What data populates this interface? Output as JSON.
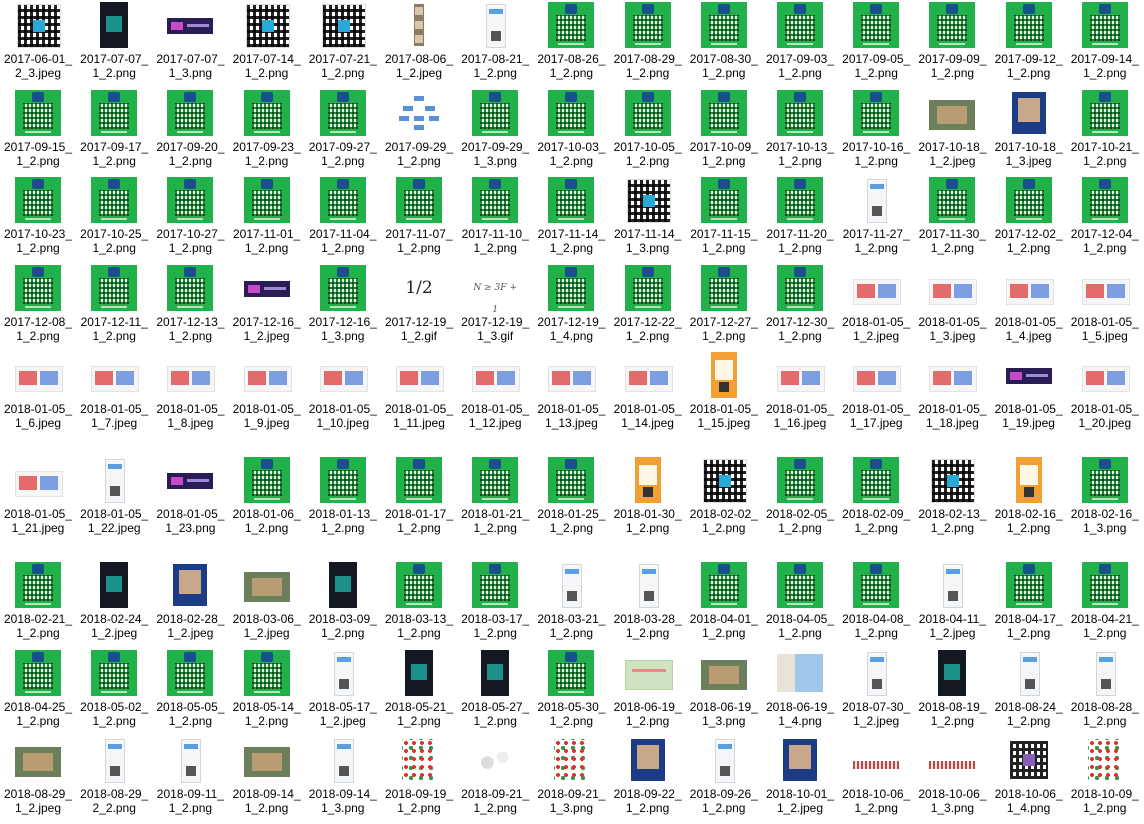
{
  "files": [
    {
      "name": "2017-06-01_2_3.jpeg",
      "thumb": "qr-plain"
    },
    {
      "name": "2017-07-07_1_2.png",
      "thumb": "dark-poster"
    },
    {
      "name": "2017-07-07_1_3.png",
      "thumb": "banner"
    },
    {
      "name": "2017-07-14_1_2.png",
      "thumb": "qr-plain"
    },
    {
      "name": "2017-07-21_1_2.png",
      "thumb": "qr-plain"
    },
    {
      "name": "2017-08-06_1_2.jpeg",
      "thumb": "strip"
    },
    {
      "name": "2017-08-21_1_2.png",
      "thumb": "doc"
    },
    {
      "name": "2017-08-26_1_2.png",
      "thumb": "qr-green"
    },
    {
      "name": "2017-08-29_1_2.png",
      "thumb": "qr-green"
    },
    {
      "name": "2017-08-30_1_2.png",
      "thumb": "qr-green"
    },
    {
      "name": "2017-09-03_1_2.png",
      "thumb": "qr-green"
    },
    {
      "name": "2017-09-05_1_2.png",
      "thumb": "qr-green"
    },
    {
      "name": "2017-09-09_1_2.png",
      "thumb": "qr-green"
    },
    {
      "name": "2017-09-12_1_2.png",
      "thumb": "qr-green"
    },
    {
      "name": "2017-09-14_1_2.png",
      "thumb": "qr-green"
    },
    {
      "name": "2017-09-15_1_2.png",
      "thumb": "qr-green"
    },
    {
      "name": "2017-09-17_1_2.png",
      "thumb": "qr-green"
    },
    {
      "name": "2017-09-20_1_2.png",
      "thumb": "qr-green"
    },
    {
      "name": "2017-09-23_1_2.png",
      "thumb": "qr-green"
    },
    {
      "name": "2017-09-27_1_2.png",
      "thumb": "qr-green"
    },
    {
      "name": "2017-09-29_1_2.png",
      "thumb": "flow"
    },
    {
      "name": "2017-09-29_1_3.png",
      "thumb": "qr-green"
    },
    {
      "name": "2017-10-03_1_2.png",
      "thumb": "qr-green"
    },
    {
      "name": "2017-10-05_1_2.png",
      "thumb": "qr-green"
    },
    {
      "name": "2017-10-09_1_2.png",
      "thumb": "qr-green"
    },
    {
      "name": "2017-10-13_1_2.png",
      "thumb": "qr-green"
    },
    {
      "name": "2017-10-16_1_2.png",
      "thumb": "qr-green"
    },
    {
      "name": "2017-10-18_1_2.jpeg",
      "thumb": "photo"
    },
    {
      "name": "2017-10-18_1_3.jpeg",
      "thumb": "poster"
    },
    {
      "name": "2017-10-21_1_2.png",
      "thumb": "qr-green"
    },
    {
      "name": "2017-10-23_1_2.png",
      "thumb": "qr-green"
    },
    {
      "name": "2017-10-25_1_2.png",
      "thumb": "qr-green"
    },
    {
      "name": "2017-10-27_1_2.png",
      "thumb": "qr-green"
    },
    {
      "name": "2017-11-01_1_2.png",
      "thumb": "qr-green"
    },
    {
      "name": "2017-11-04_1_2.png",
      "thumb": "qr-green"
    },
    {
      "name": "2017-11-07_1_2.png",
      "thumb": "qr-green"
    },
    {
      "name": "2017-11-10_1_2.png",
      "thumb": "qr-green"
    },
    {
      "name": "2017-11-14_1_2.png",
      "thumb": "qr-green"
    },
    {
      "name": "2017-11-14_1_3.png",
      "thumb": "qr-plain"
    },
    {
      "name": "2017-11-15_1_2.png",
      "thumb": "qr-green"
    },
    {
      "name": "2017-11-20_1_2.png",
      "thumb": "qr-green"
    },
    {
      "name": "2017-11-27_1_2.png",
      "thumb": "doc"
    },
    {
      "name": "2017-11-30_1_2.png",
      "thumb": "qr-green"
    },
    {
      "name": "2017-12-02_1_2.png",
      "thumb": "qr-green"
    },
    {
      "name": "2017-12-04_1_2.png",
      "thumb": "qr-green"
    },
    {
      "name": "2017-12-08_1_2.png",
      "thumb": "qr-green"
    },
    {
      "name": "2017-12-11_1_2.png",
      "thumb": "qr-green"
    },
    {
      "name": "2017-12-13_1_2.png",
      "thumb": "qr-green"
    },
    {
      "name": "2017-12-16_1_2.jpeg",
      "thumb": "banner"
    },
    {
      "name": "2017-12-16_1_3.png",
      "thumb": "qr-green"
    },
    {
      "name": "2017-12-19_1_2.gif",
      "thumb": "gif-half",
      "math": "1/2"
    },
    {
      "name": "2017-12-19_1_3.gif",
      "thumb": "gif-formula",
      "math": "N ≥ 3F + 1"
    },
    {
      "name": "2017-12-19_1_4.png",
      "thumb": "qr-green"
    },
    {
      "name": "2017-12-22_1_2.png",
      "thumb": "qr-green"
    },
    {
      "name": "2017-12-27_1_2.png",
      "thumb": "qr-green"
    },
    {
      "name": "2017-12-30_1_2.png",
      "thumb": "qr-green"
    },
    {
      "name": "2018-01-05_1_2.jpeg",
      "thumb": "wide"
    },
    {
      "name": "2018-01-05_1_3.jpeg",
      "thumb": "wide"
    },
    {
      "name": "2018-01-05_1_4.jpeg",
      "thumb": "wide"
    },
    {
      "name": "2018-01-05_1_5.jpeg",
      "thumb": "wide"
    },
    {
      "name": "2018-01-05_1_6.jpeg",
      "thumb": "wide"
    },
    {
      "name": "2018-01-05_1_7.jpeg",
      "thumb": "wide"
    },
    {
      "name": "2018-01-05_1_8.jpeg",
      "thumb": "wide"
    },
    {
      "name": "2018-01-05_1_9.jpeg",
      "thumb": "wide"
    },
    {
      "name": "2018-01-05_1_10.jpeg",
      "thumb": "wide"
    },
    {
      "name": "2018-01-05_1_11.jpeg",
      "thumb": "wide"
    },
    {
      "name": "2018-01-05_1_12.jpeg",
      "thumb": "wide"
    },
    {
      "name": "2018-01-05_1_13.jpeg",
      "thumb": "wide"
    },
    {
      "name": "2018-01-05_1_14.jpeg",
      "thumb": "wide"
    },
    {
      "name": "2018-01-05_1_15.jpeg",
      "thumb": "tall"
    },
    {
      "name": "2018-01-05_1_16.jpeg",
      "thumb": "wide"
    },
    {
      "name": "2018-01-05_1_17.jpeg",
      "thumb": "wide"
    },
    {
      "name": "2018-01-05_1_18.jpeg",
      "thumb": "wide"
    },
    {
      "name": "2018-01-05_1_19.jpeg",
      "thumb": "banner"
    },
    {
      "name": "2018-01-05_1_20.jpeg",
      "thumb": "wide"
    },
    {
      "name": "2018-01-05_1_21.jpeg",
      "thumb": "wide"
    },
    {
      "name": "2018-01-05_1_22.jpeg",
      "thumb": "doc"
    },
    {
      "name": "2018-01-05_1_23.png",
      "thumb": "banner"
    },
    {
      "name": "2018-01-06_1_2.png",
      "thumb": "qr-green"
    },
    {
      "name": "2018-01-13_1_2.png",
      "thumb": "qr-green"
    },
    {
      "name": "2018-01-17_1_2.png",
      "thumb": "qr-green"
    },
    {
      "name": "2018-01-21_1_2.png",
      "thumb": "qr-green"
    },
    {
      "name": "2018-01-25_1_2.png",
      "thumb": "qr-green"
    },
    {
      "name": "2018-01-30_1_2.png",
      "thumb": "tall"
    },
    {
      "name": "2018-02-02_1_2.png",
      "thumb": "qr-plain"
    },
    {
      "name": "2018-02-05_1_2.png",
      "thumb": "qr-green"
    },
    {
      "name": "2018-02-09_1_2.png",
      "thumb": "qr-green"
    },
    {
      "name": "2018-02-13_1_2.png",
      "thumb": "qr-plain"
    },
    {
      "name": "2018-02-16_1_2.png",
      "thumb": "tall"
    },
    {
      "name": "2018-02-16_1_3.png",
      "thumb": "qr-green"
    },
    {
      "name": "2018-02-21_1_2.png",
      "thumb": "qr-green"
    },
    {
      "name": "2018-02-24_1_2.jpeg",
      "thumb": "dark-poster"
    },
    {
      "name": "2018-02-28_1_2.jpeg",
      "thumb": "poster"
    },
    {
      "name": "2018-03-06_1_2.jpeg",
      "thumb": "photo"
    },
    {
      "name": "2018-03-09_1_2.png",
      "thumb": "dark-poster"
    },
    {
      "name": "2018-03-13_1_2.png",
      "thumb": "qr-green"
    },
    {
      "name": "2018-03-17_1_2.png",
      "thumb": "qr-green"
    },
    {
      "name": "2018-03-21_1_2.png",
      "thumb": "doc"
    },
    {
      "name": "2018-03-28_1_2.png",
      "thumb": "doc"
    },
    {
      "name": "2018-04-01_1_2.png",
      "thumb": "qr-green"
    },
    {
      "name": "2018-04-05_1_2.png",
      "thumb": "qr-green"
    },
    {
      "name": "2018-04-08_1_2.png",
      "thumb": "qr-green"
    },
    {
      "name": "2018-04-11_1_2.jpeg",
      "thumb": "doc"
    },
    {
      "name": "2018-04-17_1_2.png",
      "thumb": "qr-green"
    },
    {
      "name": "2018-04-21_1_2.png",
      "thumb": "qr-green"
    },
    {
      "name": "2018-04-25_1_2.png",
      "thumb": "qr-green"
    },
    {
      "name": "2018-05-02_1_2.png",
      "thumb": "qr-green"
    },
    {
      "name": "2018-05-05_1_2.png",
      "thumb": "qr-green"
    },
    {
      "name": "2018-05-14_1_2.png",
      "thumb": "qr-green"
    },
    {
      "name": "2018-05-17_1_2.jpeg",
      "thumb": "doc"
    },
    {
      "name": "2018-05-21_1_2.png",
      "thumb": "dark-poster"
    },
    {
      "name": "2018-05-27_1_2.png",
      "thumb": "dark-poster"
    },
    {
      "name": "2018-05-30_1_2.png",
      "thumb": "qr-green"
    },
    {
      "name": "2018-06-19_1_2.png",
      "thumb": "map"
    },
    {
      "name": "2018-06-19_1_3.png",
      "thumb": "photo"
    },
    {
      "name": "2018-06-19_1_4.png",
      "thumb": "map-big"
    },
    {
      "name": "2018-07-30_1_2.jpeg",
      "thumb": "doc"
    },
    {
      "name": "2018-08-19_1_2.png",
      "thumb": "dark-poster"
    },
    {
      "name": "2018-08-24_1_2.png",
      "thumb": "doc"
    },
    {
      "name": "2018-08-28_1_2.png",
      "thumb": "doc"
    },
    {
      "name": "2018-08-29_1_2.jpeg",
      "thumb": "photo"
    },
    {
      "name": "2018-08-29_2_2.png",
      "thumb": "doc"
    },
    {
      "name": "2018-09-11_1_2.png",
      "thumb": "doc"
    },
    {
      "name": "2018-09-14_1_2.png",
      "thumb": "photo"
    },
    {
      "name": "2018-09-14_1_3.png",
      "thumb": "doc"
    },
    {
      "name": "2018-09-19_1_2.png",
      "thumb": "fun"
    },
    {
      "name": "2018-09-21_1_2.png",
      "thumb": "crystal"
    },
    {
      "name": "2018-09-21_1_3.png",
      "thumb": "fun"
    },
    {
      "name": "2018-09-22_1_2.png",
      "thumb": "poster"
    },
    {
      "name": "2018-09-26_1_2.png",
      "thumb": "doc"
    },
    {
      "name": "2018-10-01_1_2.jpeg",
      "thumb": "poster"
    },
    {
      "name": "2018-10-06_1_2.png",
      "thumb": "bar"
    },
    {
      "name": "2018-10-06_1_3.png",
      "thumb": "bar"
    },
    {
      "name": "2018-10-06_1_4.png",
      "thumb": "qr-purple"
    },
    {
      "name": "2018-10-09_1_2.png",
      "thumb": "fun"
    }
  ]
}
